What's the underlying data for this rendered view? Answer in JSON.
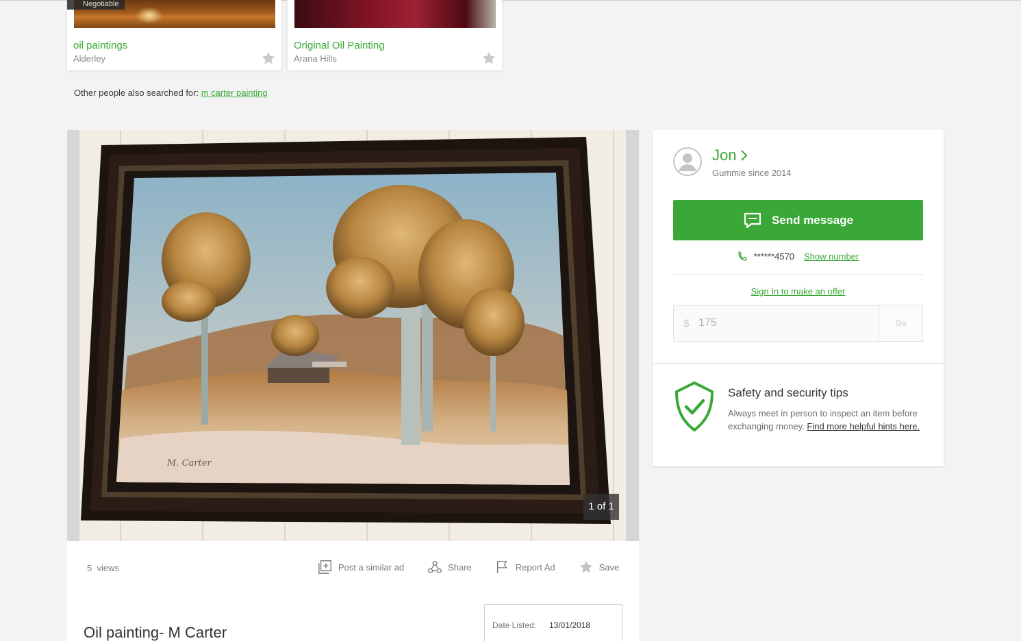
{
  "related": [
    {
      "badge": "Negotiable",
      "title": "oil paintings",
      "location": "Alderley"
    },
    {
      "badge": "",
      "title": "Original Oil Painting",
      "location": "Arana Hills"
    }
  ],
  "also_searched": {
    "prefix": "Other people also searched for: ",
    "link": "m carter painting"
  },
  "gallery": {
    "counter": "1 of 1"
  },
  "details": {
    "views_count": "5",
    "views_label": "views",
    "actions": {
      "post_similar": "Post a similar ad",
      "share": "Share",
      "report": "Report Ad",
      "save": "Save"
    },
    "title": "Oil painting- M Carter",
    "date_label": "Date Listed:",
    "date_value": "13/01/2018"
  },
  "seller": {
    "name": "Jon",
    "since": "Gummie since 2014",
    "send_message": "Send message",
    "phone_masked": "******4570",
    "show_number": "Show number",
    "offer_link": "Sign In to make an offer",
    "offer_currency": "$",
    "offer_amount": "175",
    "go": "Go"
  },
  "safety": {
    "title": "Safety and security tips",
    "text": "Always meet in person to inspect an item before exchanging money. ",
    "link": "Find more helpful hints here."
  },
  "colors": {
    "brand_green": "#3aa836",
    "background": "#f3f3f3"
  }
}
